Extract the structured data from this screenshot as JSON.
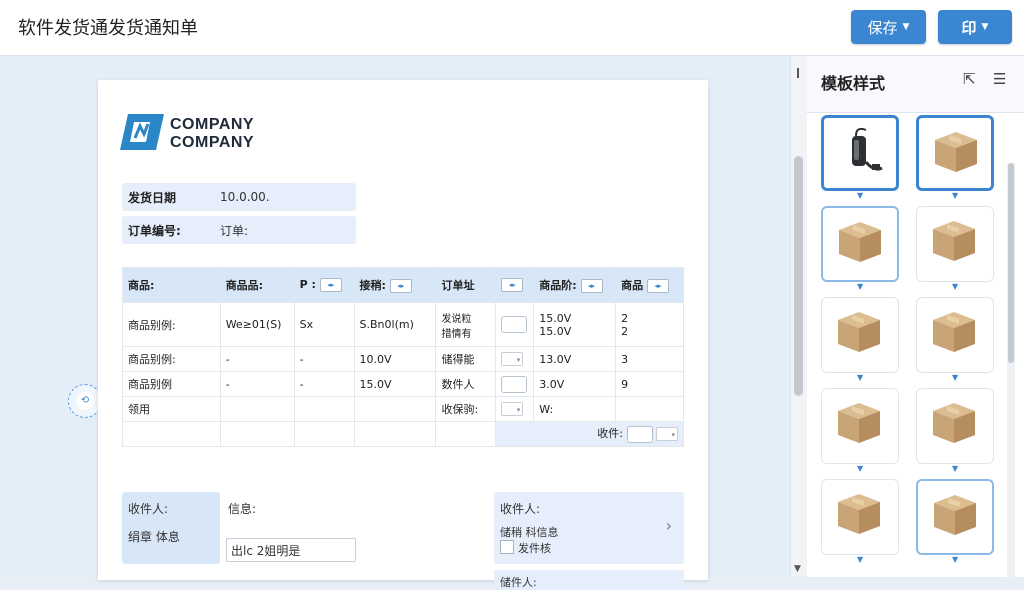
{
  "app": {
    "title": "软件发货通发货通知单"
  },
  "toolbar": {
    "save_label": "保存",
    "print_label": "印"
  },
  "logo": {
    "line1": "COMPANY",
    "line2": "COMPANY"
  },
  "doc": {
    "ship_date_label": "发货日期",
    "ship_date_value": "10.0.00.",
    "order_no_label": "订单编号:",
    "order_no_value": "订单:",
    "table": {
      "headers": [
        "商品:",
        "商品品:",
        "P :",
        "接稍:",
        "订单址",
        "",
        "商品阶:",
        "商品"
      ],
      "rows": [
        [
          "商品别例:",
          "We≥01(S)",
          "Sx",
          "S.Bn0l(m)",
          "发说粒\n措情有",
          "",
          "15.0V\n15.0V",
          "2\n2"
        ],
        [
          "商品别例:",
          "-",
          "-",
          "10.0V",
          "储得能",
          "",
          "13.0V",
          "3"
        ],
        [
          "商品别例",
          "-",
          "-",
          "15.0V",
          "数件人",
          "",
          "3.0V",
          "9"
        ],
        [
          "领用",
          "",
          "",
          "",
          "收保驹:",
          "",
          "W:",
          ""
        ]
      ],
      "footer_label": "收件:"
    },
    "recv_left": {
      "title": "收件人:",
      "sub": "绢章 体息"
    },
    "info_title": "信息:",
    "info_input": "出lc 2姐明是",
    "recv_right": {
      "title": "收件人:",
      "sub": "储稍 科信息",
      "checkbox_label": "发件核"
    },
    "recv_right2": "储件人:"
  },
  "panel": {
    "title": "模板样式",
    "thumbnails": [
      "charger-image",
      "box-image",
      "box-image",
      "box-image",
      "box-image",
      "box-image",
      "box-image",
      "box-image",
      "box-image",
      "box-image"
    ],
    "selected_indices": [
      0,
      1
    ]
  },
  "colors": {
    "accent": "#3a86d1",
    "header_fill": "#d8e7f8",
    "box": "#c9a477"
  }
}
